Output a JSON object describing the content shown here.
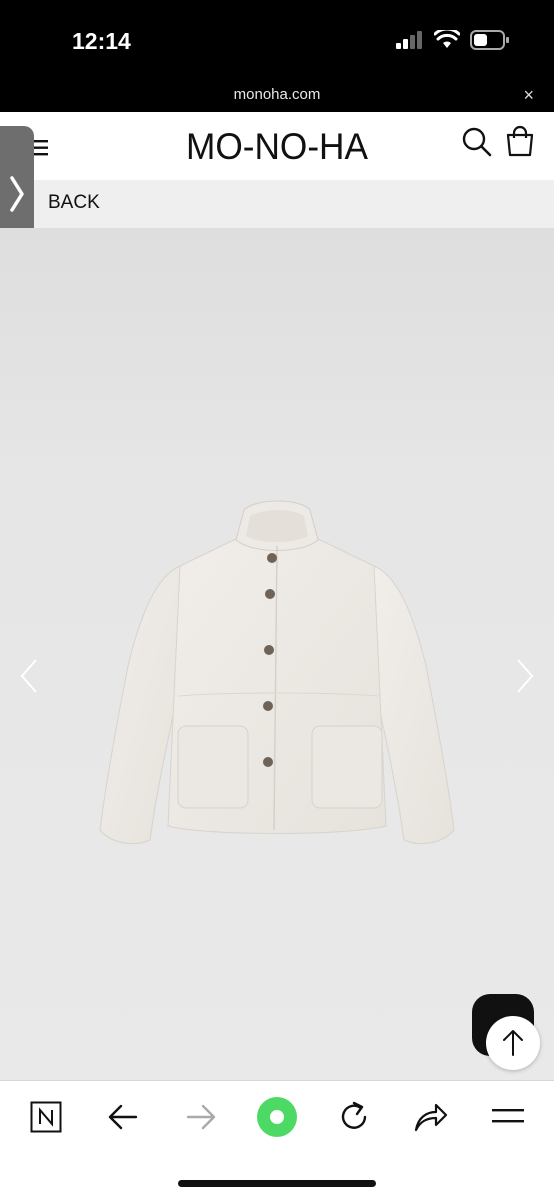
{
  "status": {
    "time": "12:14",
    "icons": [
      "signal-icon",
      "wifi-icon",
      "battery-icon"
    ]
  },
  "browser": {
    "url": "monoha.com",
    "close_label": "×"
  },
  "site": {
    "logo": "MO-NO-HA",
    "back_label": "BACK",
    "icons": [
      "menu-icon",
      "search-icon",
      "shopping-bag-icon"
    ]
  },
  "product": {
    "image": "jacket-image",
    "color": "#ece8e3"
  },
  "toolbar": {
    "icons": [
      "notes-icon",
      "back-arrow-icon",
      "forward-arrow-icon",
      "home-icon",
      "reload-icon",
      "share-icon",
      "menu-lines-icon"
    ],
    "accent": "#4cd964"
  }
}
